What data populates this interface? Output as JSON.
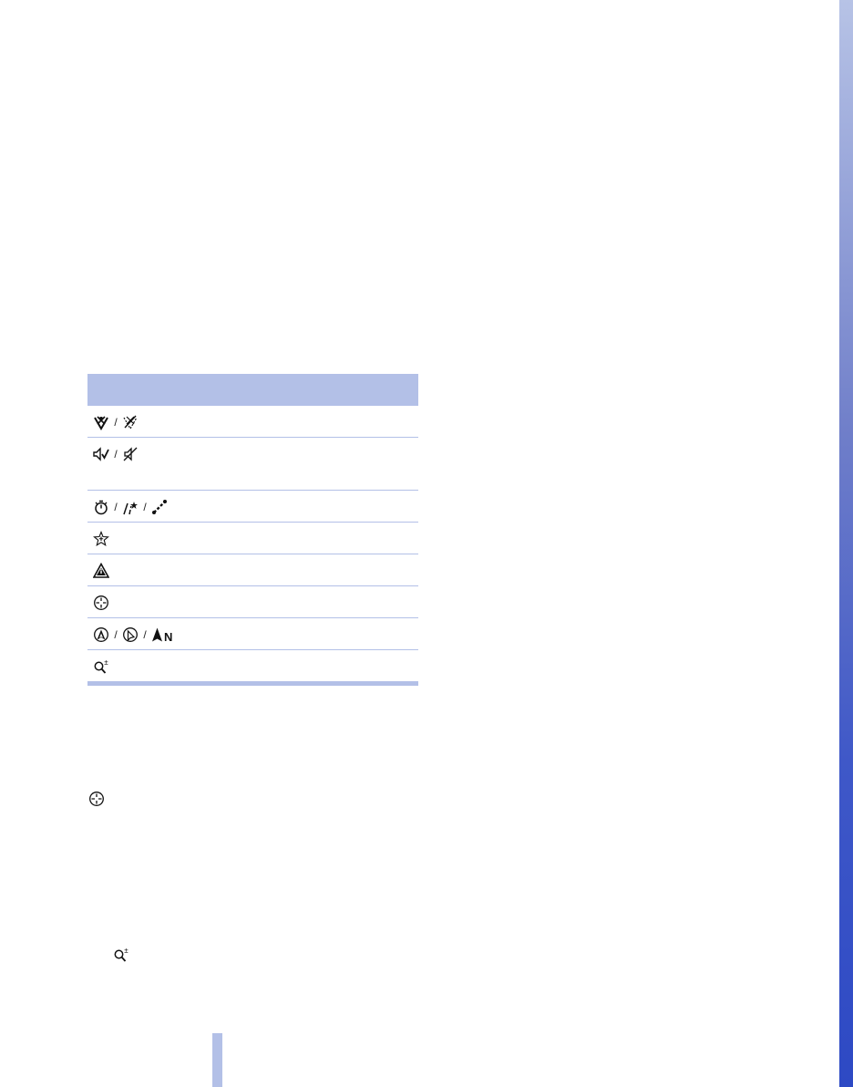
{
  "page": {
    "accent_color": "#b3c0e7",
    "edge_bar_color": "#2d49c4"
  },
  "icon_table": {
    "header_label": "",
    "rows": [
      {
        "icons": [
          "traffic-obstruction-filter-icon",
          "traffic-obstruction-filter-off-icon"
        ]
      },
      {
        "icons": [
          "voice-instructions-on-icon",
          "voice-instructions-muted-icon"
        ]
      },
      {
        "icons": [
          "fastest-route-icon",
          "short-route-icon",
          "route-segment-icon"
        ]
      },
      {
        "icons": [
          "points-of-interest-icon"
        ]
      },
      {
        "icons": [
          "traffic-warning-icon"
        ]
      },
      {
        "icons": [
          "crosshairs-icon"
        ]
      },
      {
        "icons": [
          "direction-of-travel-icon",
          "map-perspective-icon",
          "north-up-icon"
        ]
      },
      {
        "icons": [
          "zoom-scale-icon"
        ]
      }
    ],
    "north_up_letter": "N",
    "zoom_plus_minus": "±"
  },
  "standalone_icons": [
    "crosshairs-icon",
    "zoom-scale-icon"
  ]
}
